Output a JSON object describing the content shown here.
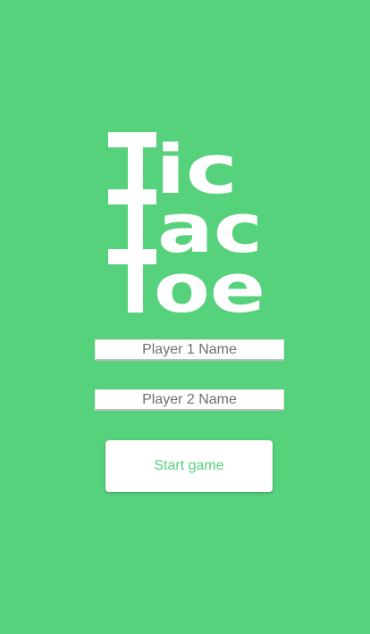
{
  "logo": {
    "line1": "ic",
    "line2": "ac",
    "line3": "oe",
    "alt_text": "Tic Tac Toe"
  },
  "form": {
    "player1_placeholder": "Player 1 Name",
    "player1_value": "",
    "player2_placeholder": "Player 2 Name",
    "player2_value": "",
    "start_label": "Start game"
  },
  "colors": {
    "background": "#56d17c",
    "logo": "#ffffff",
    "button_text": "#56d17c"
  }
}
